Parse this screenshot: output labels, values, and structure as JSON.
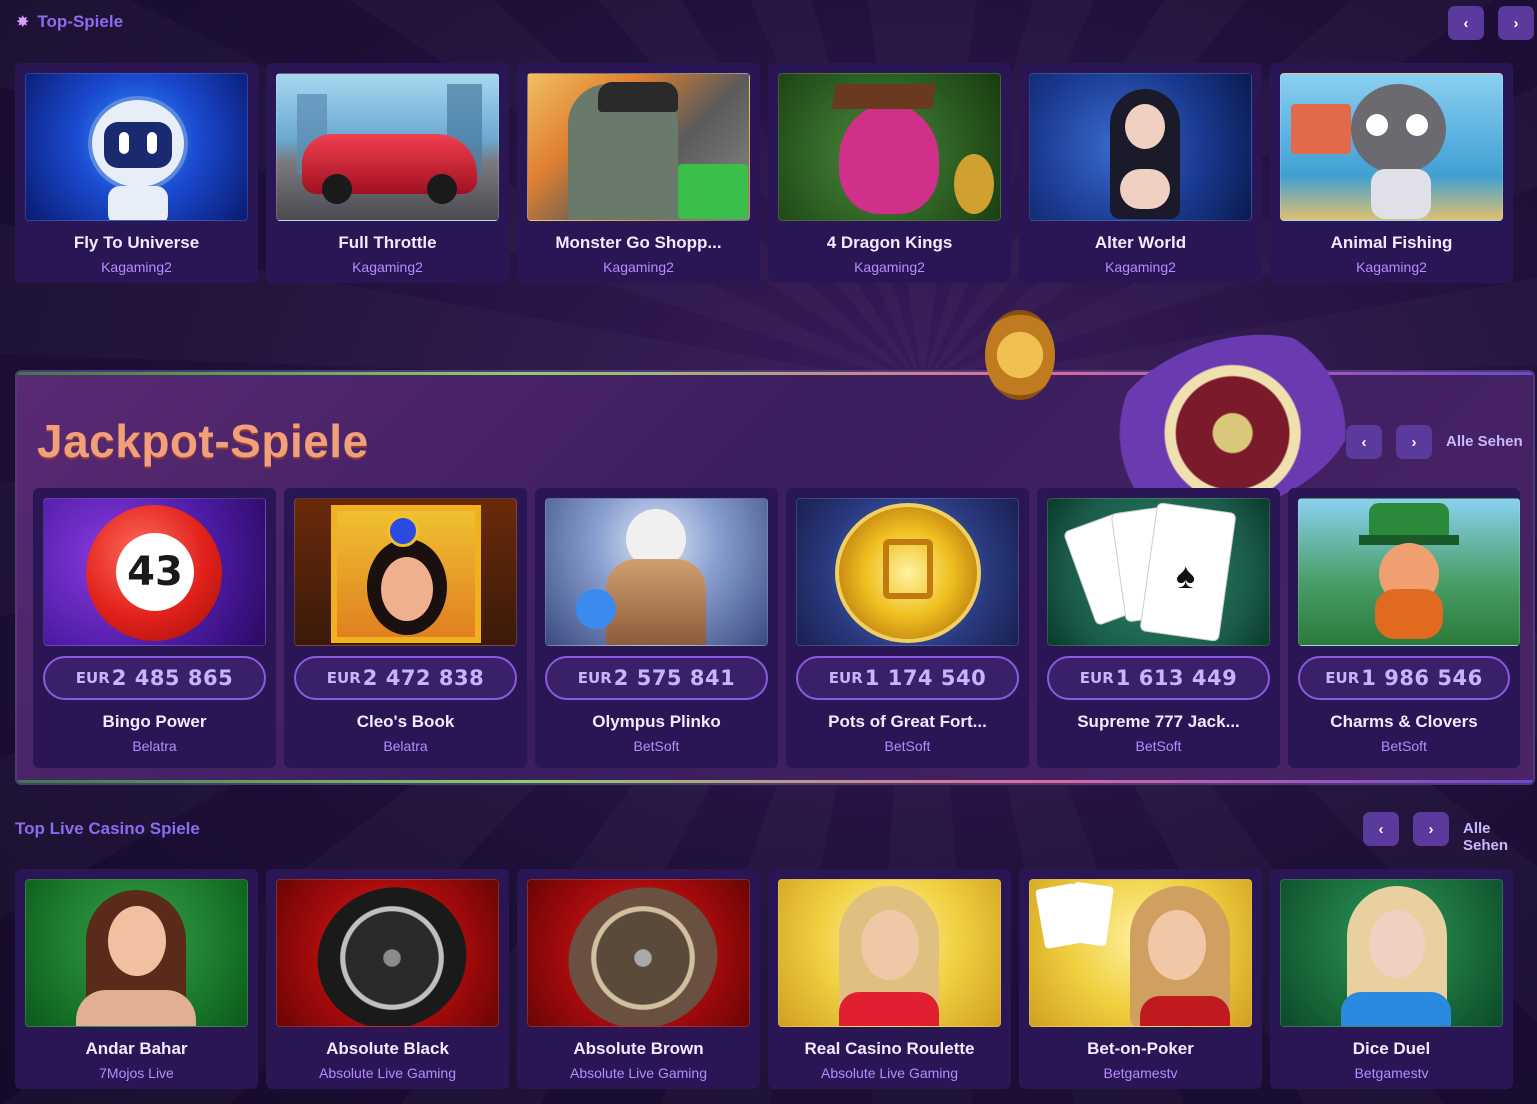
{
  "top_games": {
    "title": "Top-Spiele",
    "prev_label": "‹",
    "next_label": "›",
    "cards": [
      {
        "title": "Fly To Universe",
        "provider": "Kagaming2"
      },
      {
        "title": "Full Throttle",
        "provider": "Kagaming2"
      },
      {
        "title": "Monster Go Shopp...",
        "provider": "Kagaming2"
      },
      {
        "title": "4 Dragon Kings",
        "provider": "Kagaming2"
      },
      {
        "title": "Alter World",
        "provider": "Kagaming2"
      },
      {
        "title": "Animal Fishing",
        "provider": "Kagaming2"
      }
    ]
  },
  "jackpot": {
    "title": "Jackpot-Spiele",
    "prev_label": "‹",
    "next_label": "›",
    "see_all": "Alle Sehen",
    "cards": [
      {
        "currency": "EUR",
        "amount": "2 485 865",
        "title": "Bingo Power",
        "provider": "Belatra",
        "ball_number": "43"
      },
      {
        "currency": "EUR",
        "amount": "2 472 838",
        "title": "Cleo's Book",
        "provider": "Belatra"
      },
      {
        "currency": "EUR",
        "amount": "2 575 841",
        "title": "Olympus Plinko",
        "provider": "BetSoft"
      },
      {
        "currency": "EUR",
        "amount": "1 174 540",
        "title": "Pots of Great Fort...",
        "provider": "BetSoft"
      },
      {
        "currency": "EUR",
        "amount": "1 613 449",
        "title": "Supreme 777 Jack...",
        "provider": "BetSoft"
      },
      {
        "currency": "EUR",
        "amount": "1 986 546",
        "title": "Charms & Clovers",
        "provider": "BetSoft"
      }
    ]
  },
  "live_casino": {
    "title": "Top Live Casino Spiele",
    "prev_label": "‹",
    "next_label": "›",
    "see_all": "Alle Sehen",
    "cards": [
      {
        "title": "Andar Bahar",
        "provider": "7Mojos Live"
      },
      {
        "title": "Absolute Black",
        "provider": "Absolute Live Gaming"
      },
      {
        "title": "Absolute Brown",
        "provider": "Absolute Live Gaming"
      },
      {
        "title": "Real Casino Roulette",
        "provider": "Absolute Live Gaming"
      },
      {
        "title": "Bet-on-Poker",
        "provider": "Betgamestv"
      },
      {
        "title": "Dice Duel",
        "provider": "Betgamestv"
      }
    ]
  },
  "colors": {
    "accent": "#8a6cf0",
    "card_bg": "#2a1654",
    "provider": "#b68cff",
    "jackpot_title": "#f2a07a"
  }
}
